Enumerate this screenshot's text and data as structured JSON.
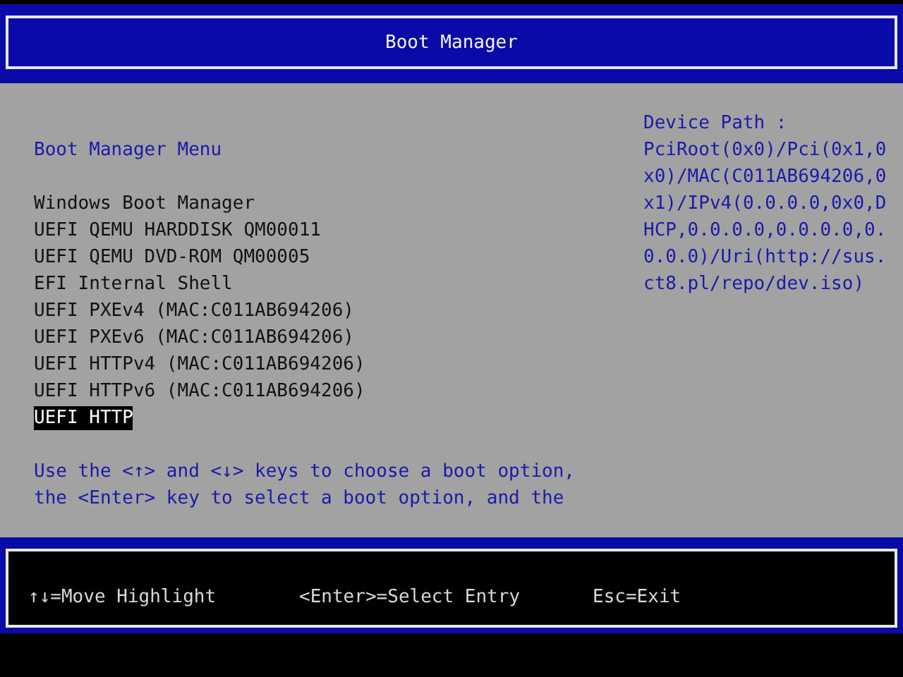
{
  "window": {
    "title": "Boot Manager"
  },
  "menu": {
    "heading": "Boot Manager Menu",
    "items": [
      {
        "label": "Windows Boot Manager",
        "selected": false
      },
      {
        "label": "UEFI QEMU HARDDISK QM00011",
        "selected": false
      },
      {
        "label": "UEFI QEMU DVD-ROM QM00005",
        "selected": false
      },
      {
        "label": "EFI Internal Shell",
        "selected": false
      },
      {
        "label": "UEFI PXEv4 (MAC:C011AB694206)",
        "selected": false
      },
      {
        "label": "UEFI PXEv6 (MAC:C011AB694206)",
        "selected": false
      },
      {
        "label": "UEFI HTTPv4 (MAC:C011AB694206)",
        "selected": false
      },
      {
        "label": "UEFI HTTPv6 (MAC:C011AB694206)",
        "selected": false
      },
      {
        "label": "UEFI HTTP",
        "selected": true
      }
    ],
    "help_lines": [
      "Use the <↑> and <↓> keys to choose a boot option,",
      "the <Enter> key to select a boot option, and the"
    ]
  },
  "device_path": {
    "heading": "Device Path :",
    "lines": [
      "PciRoot(0x0)/Pci(0x1,0",
      "x0)/MAC(C011AB694206,0",
      "x1)/IPv4(0.0.0.0,0x0,D",
      "HCP,0.0.0.0,0.0.0.0,0.",
      "0.0.0)/Uri(http://sus.",
      "ct8.pl/repo/dev.iso)"
    ]
  },
  "status_bar": [
    "↑↓=Move Highlight",
    "<Enter>=Select Entry",
    "Esc=Exit"
  ]
}
